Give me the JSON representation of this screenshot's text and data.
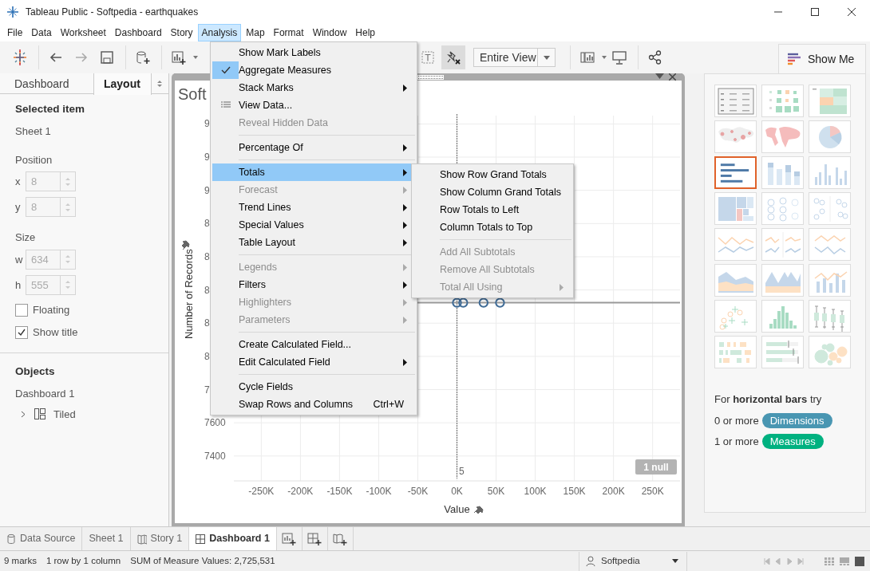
{
  "window": {
    "title": "Tableau Public - Softpedia - earthquakes"
  },
  "menu_bar": [
    {
      "label": "File",
      "selected": false
    },
    {
      "label": "Data",
      "selected": false
    },
    {
      "label": "Worksheet",
      "selected": false
    },
    {
      "label": "Dashboard",
      "selected": false
    },
    {
      "label": "Story",
      "selected": false
    },
    {
      "label": "Analysis",
      "selected": true
    },
    {
      "label": "Map",
      "selected": false
    },
    {
      "label": "Format",
      "selected": false
    },
    {
      "label": "Window",
      "selected": false
    },
    {
      "label": "Help",
      "selected": false
    }
  ],
  "toolbar": {
    "fit": "Entire View"
  },
  "left_panel": {
    "tabs": [
      {
        "label": "Dashboard",
        "selected": false
      },
      {
        "label": "Layout",
        "selected": true
      }
    ],
    "selected_heading": "Selected item",
    "selected_name": "Sheet 1",
    "groups": [
      {
        "heading": "Position",
        "fields": [
          {
            "label": "x",
            "value": "8",
            "disabled": true
          },
          {
            "label": "y",
            "value": "8",
            "disabled": true
          }
        ]
      },
      {
        "heading": "Size",
        "fields": [
          {
            "label": "w",
            "value": "634",
            "disabled": true
          },
          {
            "label": "h",
            "value": "555",
            "disabled": true
          }
        ]
      }
    ],
    "options": [
      {
        "label": "Floating",
        "checked": false
      },
      {
        "label": "Show title",
        "checked": true
      }
    ],
    "objects_heading": "Objects",
    "objects_root": "Dashboard 1",
    "objects": [
      {
        "label": "Tiled",
        "expanded": false
      }
    ]
  },
  "dashboard": {
    "title": "Soft",
    "corner_label": "5",
    "null_badge": "1 null",
    "chart_data": {
      "type": "scatter",
      "xlabel": "Value",
      "ylabel": "Number of Records",
      "x": [
        0,
        8000,
        34000,
        55000
      ],
      "values": [
        8323,
        8323,
        8323,
        8323
      ],
      "xlim": [
        -285000,
        285000
      ],
      "ylim": [
        7250,
        9450
      ],
      "xticks": [
        {
          "value": -250000,
          "label": "-250K"
        },
        {
          "value": -200000,
          "label": "-200K"
        },
        {
          "value": -150000,
          "label": "-150K"
        },
        {
          "value": -100000,
          "label": "-100K"
        },
        {
          "value": -50000,
          "label": "-50K"
        },
        {
          "value": 0,
          "label": "0K"
        },
        {
          "value": 50000,
          "label": "50K"
        },
        {
          "value": 100000,
          "label": "100K"
        },
        {
          "value": 150000,
          "label": "150K"
        },
        {
          "value": 200000,
          "label": "200K"
        },
        {
          "value": 250000,
          "label": "250K"
        }
      ],
      "yticks": [
        7600,
        7400
      ],
      "grid": true,
      "ref_lines": [
        {
          "axis": "x",
          "value": 0
        },
        {
          "axis": "y",
          "value": 8323
        }
      ]
    },
    "partial_tick_labels": [
      "9",
      "9",
      "9",
      "8",
      "8",
      "8",
      "8",
      "8",
      "7"
    ]
  },
  "analysis_menu": {
    "items": [
      {
        "kind": "item",
        "label": "Show Mark Labels",
        "checked": false,
        "disabled": false,
        "submenu": false,
        "has_icon": false,
        "selected": false
      },
      {
        "kind": "item",
        "label": "Aggregate Measures",
        "checked": true,
        "disabled": false,
        "submenu": false,
        "has_icon": false,
        "selected": false
      },
      {
        "kind": "item",
        "label": "Stack Marks",
        "checked": false,
        "disabled": false,
        "submenu": true,
        "has_icon": false,
        "selected": false
      },
      {
        "kind": "item",
        "label": "View Data...",
        "checked": false,
        "disabled": false,
        "submenu": false,
        "has_icon": true,
        "selected": false
      },
      {
        "kind": "item",
        "label": "Reveal Hidden Data",
        "checked": false,
        "disabled": true,
        "submenu": false,
        "has_icon": false,
        "selected": false
      },
      {
        "kind": "separator"
      },
      {
        "kind": "item",
        "label": "Percentage Of",
        "checked": false,
        "disabled": false,
        "submenu": true,
        "has_icon": false,
        "selected": false
      },
      {
        "kind": "separator"
      },
      {
        "kind": "item",
        "label": "Totals",
        "checked": false,
        "disabled": false,
        "submenu": true,
        "has_icon": false,
        "selected": true
      },
      {
        "kind": "item",
        "label": "Forecast",
        "checked": false,
        "disabled": true,
        "submenu": true,
        "has_icon": false,
        "selected": false
      },
      {
        "kind": "item",
        "label": "Trend Lines",
        "checked": false,
        "disabled": false,
        "submenu": true,
        "has_icon": false,
        "selected": false
      },
      {
        "kind": "item",
        "label": "Special Values",
        "checked": false,
        "disabled": false,
        "submenu": true,
        "has_icon": false,
        "selected": false
      },
      {
        "kind": "item",
        "label": "Table Layout",
        "checked": false,
        "disabled": false,
        "submenu": true,
        "has_icon": false,
        "selected": false
      },
      {
        "kind": "separator"
      },
      {
        "kind": "item",
        "label": "Legends",
        "checked": false,
        "disabled": true,
        "submenu": true,
        "has_icon": false,
        "selected": false
      },
      {
        "kind": "item",
        "label": "Filters",
        "checked": false,
        "disabled": false,
        "submenu": true,
        "has_icon": false,
        "selected": false
      },
      {
        "kind": "item",
        "label": "Highlighters",
        "checked": false,
        "disabled": true,
        "submenu": true,
        "has_icon": false,
        "selected": false
      },
      {
        "kind": "item",
        "label": "Parameters",
        "checked": false,
        "disabled": true,
        "submenu": true,
        "has_icon": false,
        "selected": false
      },
      {
        "kind": "separator"
      },
      {
        "kind": "item",
        "label": "Create Calculated Field...",
        "checked": false,
        "disabled": false,
        "submenu": false,
        "has_icon": false,
        "selected": false
      },
      {
        "kind": "item",
        "label": "Edit Calculated Field",
        "checked": false,
        "disabled": false,
        "submenu": true,
        "has_icon": false,
        "selected": false
      },
      {
        "kind": "separator"
      },
      {
        "kind": "item",
        "label": "Cycle Fields",
        "checked": false,
        "disabled": false,
        "submenu": false,
        "has_icon": false,
        "selected": false
      },
      {
        "kind": "item",
        "label": "Swap Rows and Columns",
        "shortcut": "Ctrl+W",
        "checked": false,
        "disabled": false,
        "submenu": false,
        "has_icon": false,
        "selected": false
      }
    ]
  },
  "totals_submenu": {
    "items": [
      {
        "kind": "item",
        "label": "Show Row Grand Totals",
        "checked": false,
        "disabled": false,
        "submenu": false,
        "has_icon": false,
        "selected": false
      },
      {
        "kind": "item",
        "label": "Show Column Grand Totals",
        "checked": false,
        "disabled": false,
        "submenu": false,
        "has_icon": false,
        "selected": false
      },
      {
        "kind": "item",
        "label": "Row Totals to Left",
        "checked": false,
        "disabled": false,
        "submenu": false,
        "has_icon": false,
        "selected": false
      },
      {
        "kind": "item",
        "label": "Column Totals to Top",
        "checked": false,
        "disabled": false,
        "submenu": false,
        "has_icon": false,
        "selected": false
      },
      {
        "kind": "separator"
      },
      {
        "kind": "item",
        "label": "Add All Subtotals",
        "checked": false,
        "disabled": true,
        "submenu": false,
        "has_icon": false,
        "selected": false
      },
      {
        "kind": "item",
        "label": "Remove All Subtotals",
        "checked": false,
        "disabled": true,
        "submenu": false,
        "has_icon": false,
        "selected": false
      },
      {
        "kind": "item",
        "label": "Total All Using",
        "checked": false,
        "disabled": true,
        "submenu": true,
        "has_icon": false,
        "selected": false
      }
    ]
  },
  "show_me": {
    "tab": "Show Me",
    "charts": [
      {
        "kind": "text-table",
        "selected": false
      },
      {
        "kind": "heat-map",
        "selected": false
      },
      {
        "kind": "highlight-table",
        "selected": false
      },
      {
        "kind": "symbol-map",
        "selected": false
      },
      {
        "kind": "filled-map",
        "selected": false
      },
      {
        "kind": "pie",
        "selected": false
      },
      {
        "kind": "hbar",
        "selected": true
      },
      {
        "kind": "stacked-bar",
        "selected": false
      },
      {
        "kind": "side-bar",
        "selected": false
      },
      {
        "kind": "treemap",
        "selected": false
      },
      {
        "kind": "circles",
        "selected": false
      },
      {
        "kind": "side-circles",
        "selected": false
      },
      {
        "kind": "line-cont",
        "selected": false
      },
      {
        "kind": "line-disc",
        "selected": false
      },
      {
        "kind": "dual-line",
        "selected": false
      },
      {
        "kind": "area-cont",
        "selected": false
      },
      {
        "kind": "area-disc",
        "selected": false
      },
      {
        "kind": "dual-combo",
        "selected": false
      },
      {
        "kind": "scatter",
        "selected": false
      },
      {
        "kind": "histogram",
        "selected": false
      },
      {
        "kind": "box-plot",
        "selected": false
      },
      {
        "kind": "gantt",
        "selected": false
      },
      {
        "kind": "bullet",
        "selected": false
      },
      {
        "kind": "bubbles",
        "selected": false
      }
    ],
    "hint": "For **horizontal bars** try",
    "requirements": [
      {
        "count": "0 or more",
        "field": "Dimensions",
        "color": "#4996b2"
      },
      {
        "count": "1 or more",
        "field": "Measures",
        "color": "#00b180"
      }
    ]
  },
  "sheet_tabs": [
    {
      "label": "Data Source",
      "kind": "datasource",
      "selected": false
    },
    {
      "label": "Sheet 1",
      "kind": "sheet",
      "selected": false
    },
    {
      "label": "Story 1",
      "kind": "story",
      "selected": false
    },
    {
      "label": "Dashboard 1",
      "kind": "dashboard",
      "selected": true
    }
  ],
  "status_bar": {
    "marks": "9 marks",
    "layout": "1 row by 1 column",
    "sum": "SUM of Measure Values: 2,725,531",
    "user": "Softpedia"
  }
}
